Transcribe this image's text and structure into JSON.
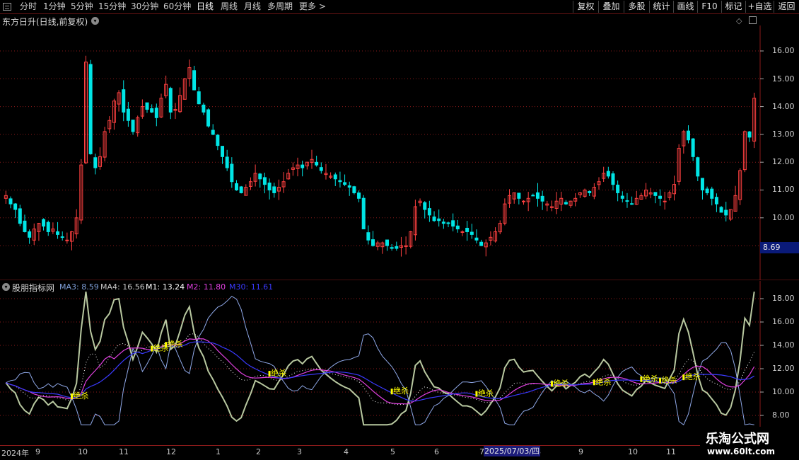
{
  "toolbar": {
    "menu_icon": "menu-icon",
    "periods": [
      "分时",
      "1分钟",
      "5分钟",
      "15分钟",
      "30分钟",
      "60分钟",
      "日线",
      "周线",
      "月线",
      "多周期",
      "更多 >"
    ],
    "active_period": "日线",
    "right_buttons": [
      "复权",
      "叠加",
      "多股",
      "统计",
      "画线",
      "F10",
      "标记",
      "+自选",
      "返回"
    ]
  },
  "main_chart": {
    "title": "东方日升(日线,前复权)",
    "price_axis": [
      "16.00",
      "15.00",
      "14.00",
      "13.00",
      "12.00",
      "11.00",
      "10.00"
    ],
    "current_price": "8.69"
  },
  "indicator": {
    "name": "股朋指标网",
    "values": [
      {
        "label": "MA3: 8.59",
        "color": "#7f9fd8"
      },
      {
        "label": "MA4: 16.56",
        "color": "#c8c8c8"
      },
      {
        "label": "M1: 13.24",
        "color": "#ffffff"
      },
      {
        "label": "M2: 11.80",
        "color": "#e040e0"
      },
      {
        "label": "M30: 11.61",
        "color": "#3a3aff"
      }
    ],
    "axis": [
      "18.00",
      "16.00",
      "14.00",
      "12.00",
      "10.00",
      "8.00"
    ],
    "signal_label": "绝杀"
  },
  "time_axis": {
    "labels": [
      "2024年",
      "9",
      "10",
      "11",
      "12",
      "1",
      "2",
      "3",
      "4",
      "5",
      "6",
      "7",
      "8",
      "9",
      "10",
      "11"
    ],
    "highlight": "2025/07/03/四"
  },
  "watermark": {
    "line1": "乐淘公式网",
    "line2": "www.60lt.com"
  },
  "colors": {
    "up": "#ff4040",
    "down": "#00e5e5",
    "grid": "#8a1a1a",
    "ma3": "#8fa8e8",
    "ma4": "#b8c8a0",
    "m1": "#ffffff",
    "m2": "#e040e0",
    "m30": "#3a3aff",
    "signal": "#ffff00"
  },
  "chart_data": {
    "type": "line",
    "title": "东方日升(日线,前复权)",
    "ylim": [
      8.3,
      16.8
    ],
    "close": [
      10.8,
      10.5,
      10.3,
      9.8,
      9.5,
      9.3,
      9.6,
      9.8,
      9.7,
      9.5,
      9.6,
      9.4,
      9.3,
      9.2,
      9.5,
      10.0,
      11.9,
      15.6,
      12.3,
      11.8,
      12.2,
      13.1,
      13.5,
      14.2,
      14.5,
      13.8,
      13.5,
      13.1,
      13.6,
      14.0,
      13.9,
      13.8,
      13.6,
      14.3,
      14.8,
      13.8,
      13.9,
      14.4,
      15.0,
      15.4,
      14.6,
      14.1,
      13.8,
      13.3,
      13.0,
      12.6,
      12.2,
      11.8,
      11.3,
      11.0,
      10.9,
      11.1,
      11.3,
      11.6,
      11.4,
      11.2,
      11.0,
      10.9,
      11.1,
      11.3,
      11.6,
      11.8,
      11.9,
      11.8,
      12.0,
      12.1,
      11.9,
      11.7,
      11.6,
      11.5,
      11.4,
      11.3,
      11.2,
      11.1,
      10.9,
      10.7,
      9.6,
      9.2,
      9.0,
      9.1,
      9.1,
      9.0,
      8.9,
      8.9,
      9.0,
      9.0,
      9.5,
      10.4,
      10.6,
      10.3,
      10.1,
      9.9,
      9.9,
      9.8,
      9.8,
      9.7,
      9.6,
      9.5,
      9.5,
      9.4,
      9.2,
      9.0,
      9.1,
      9.3,
      9.5,
      9.8,
      10.5,
      10.8,
      10.9,
      10.7,
      10.6,
      10.7,
      10.8,
      10.7,
      10.6,
      10.5,
      10.4,
      10.6,
      10.7,
      10.5,
      10.6,
      10.7,
      10.9,
      11.0,
      10.9,
      11.1,
      11.3,
      11.6,
      11.5,
      11.2,
      10.9,
      10.7,
      10.6,
      10.5,
      10.7,
      10.8,
      11.0,
      10.9,
      10.8,
      10.7,
      10.6,
      10.9,
      11.2,
      12.5,
      13.1,
      12.8,
      12.2,
      11.5,
      11.0,
      10.9,
      10.7,
      10.5,
      10.2,
      10.1,
      10.3,
      10.8,
      11.7,
      13.1,
      12.9,
      14.3
    ]
  }
}
